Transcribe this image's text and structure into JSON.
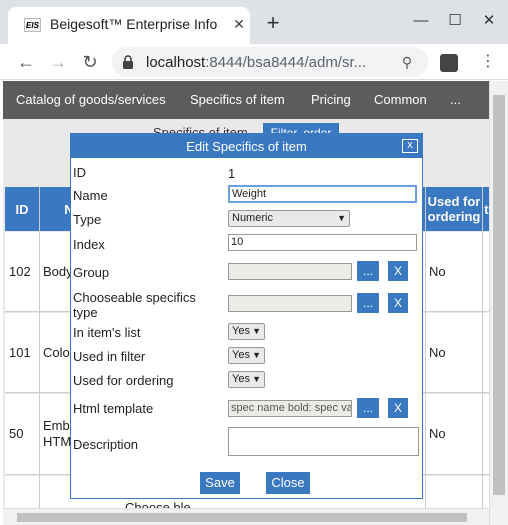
{
  "browser": {
    "tab_title": "Beigesoft™ Enterprise Info",
    "favicon_text": "EIS",
    "url_host": "localhost",
    "url_rest": ":8444/bsa8444/adm/sr..."
  },
  "appnav": {
    "items": [
      "Catalog of goods/services",
      "Specifics of item",
      "Pricing",
      "Common",
      "..."
    ]
  },
  "page": {
    "subtitle": "Specifics of item",
    "filter_button": "Filter, order",
    "columns": [
      "ID",
      "N",
      "Used for ordering",
      "te"
    ],
    "rows": [
      {
        "id": "102",
        "name": "Body",
        "used_for_ordering": "No"
      },
      {
        "id": "101",
        "name": "Color",
        "used_for_ordering": "No"
      },
      {
        "id": "50",
        "name": "Embe HTM",
        "used_for_ordering": "No"
      },
      {
        "id": "",
        "name": "",
        "extra": "Choose ble"
      }
    ]
  },
  "dialog": {
    "title": "Edit Specifics of item",
    "close_label": "x",
    "fields": {
      "id_label": "ID",
      "id_value": "1",
      "name_label": "Name",
      "name_value": "Weight",
      "type_label": "Type",
      "type_value": "Numeric",
      "index_label": "Index",
      "index_value": "10",
      "group_label": "Group",
      "group_value": "",
      "chooseable_label": "Chooseable specifics type",
      "chooseable_value": "",
      "in_list_label": "In item's list",
      "in_list_value": "Yes",
      "used_filter_label": "Used in filter",
      "used_filter_value": "Yes",
      "used_ordering_label": "Used for ordering",
      "used_ordering_value": "Yes",
      "html_template_label": "Html template",
      "html_template_value": "spec name bold: spec va",
      "description_label": "Description",
      "description_value": ""
    },
    "select_button_label": "...",
    "clear_button_label": "X",
    "save_label": "Save",
    "cancel_label": "Close"
  },
  "colors": {
    "accent": "#3a78c2",
    "nav_bg": "#5c5c5c"
  }
}
